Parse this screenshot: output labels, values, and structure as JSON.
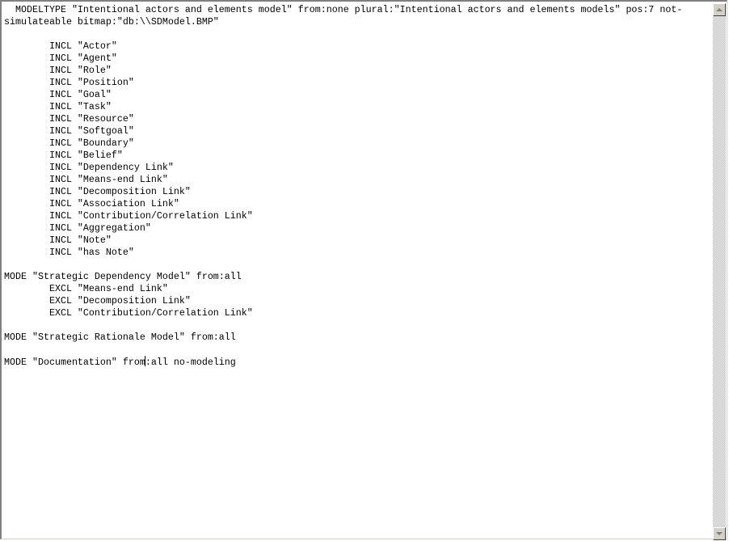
{
  "editor": {
    "lines": [
      "  MODELTYPE \"Intentional actors and elements model\" from:none plural:\"Intentional actors and elements models\" pos:7 not-",
      "simulateable bitmap:\"db:\\\\SDModel.BMP\"",
      "",
      "        INCL \"Actor\"",
      "        INCL \"Agent\"",
      "        INCL \"Role\"",
      "        INCL \"Position\"",
      "        INCL \"Goal\"",
      "        INCL \"Task\"",
      "        INCL \"Resource\"",
      "        INCL \"Softgoal\"",
      "        INCL \"Boundary\"",
      "        INCL \"Belief\"",
      "        INCL \"Dependency Link\"",
      "        INCL \"Means-end Link\"",
      "        INCL \"Decomposition Link\"",
      "        INCL \"Association Link\"",
      "        INCL \"Contribution/Correlation Link\"",
      "        INCL \"Aggregation\"",
      "        INCL \"Note\"",
      "        INCL \"has Note\"",
      "",
      "MODE \"Strategic Dependency Model\" from:all",
      "        EXCL \"Means-end Link\"",
      "        EXCL \"Decomposition Link\"",
      "        EXCL \"Contribution/Correlation Link\"",
      "",
      "MODE \"Strategic Rationale Model\" from:all",
      ""
    ],
    "caret_line_before": "MODE \"Documentation\" from",
    "caret_line_after": ":all no-modeling"
  },
  "scrollbar": {
    "up_icon": "arrow-up-icon",
    "down_icon": "arrow-down-icon"
  }
}
